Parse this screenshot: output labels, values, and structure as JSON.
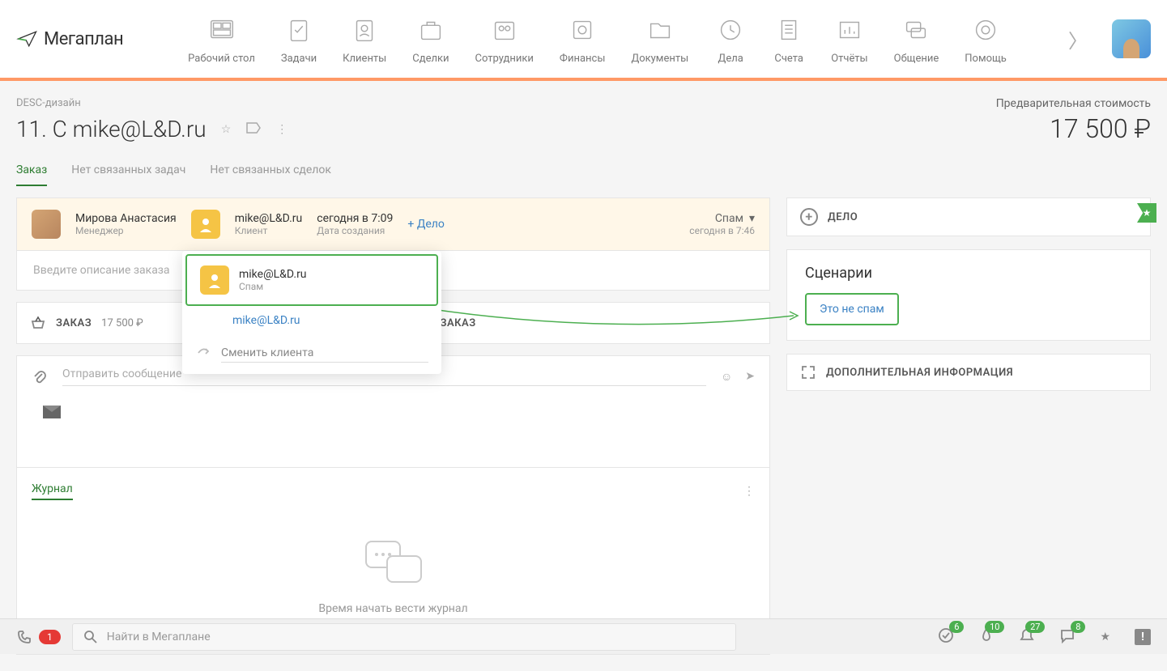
{
  "logo_text": "Мегаплан",
  "nav": [
    {
      "label": "Рабочий стол"
    },
    {
      "label": "Задачи"
    },
    {
      "label": "Клиенты"
    },
    {
      "label": "Сделки"
    },
    {
      "label": "Сотрудники"
    },
    {
      "label": "Финансы"
    },
    {
      "label": "Документы"
    },
    {
      "label": "Дела"
    },
    {
      "label": "Счета"
    },
    {
      "label": "Отчёты"
    },
    {
      "label": "Общение"
    },
    {
      "label": "Помощь"
    }
  ],
  "breadcrumb": "DESC-дизайн",
  "page_title": "11. С mike@L&D.ru",
  "price": {
    "label": "Предварительная стоимость",
    "value": "17 500 ₽"
  },
  "tabs": {
    "order": "Заказ",
    "no_tasks": "Нет связанных задач",
    "no_deals": "Нет связанных сделок"
  },
  "order_row": {
    "manager_name": "Мирова Анастасия",
    "manager_role": "Менеджер",
    "client_email": "mike@L&D.ru",
    "client_role": "Клиент",
    "created": "сегодня в 7:09",
    "created_label": "Дата создания",
    "add_deal": "+ Дело",
    "status": "Спам",
    "status_time": "сегодня в 7:46"
  },
  "desc_placeholder": "Введите описание заказа",
  "order_block": {
    "label": "ЗАКАЗ",
    "value": "17 500 ₽"
  },
  "order_block2": {
    "label": "ЗАКАЗ"
  },
  "msg_placeholder": "Отправить сообщение",
  "journal": {
    "tab": "Журнал",
    "empty": "Время начать вести журнал"
  },
  "side": {
    "deal": "ДЕЛО",
    "scenarios": "Сценарии",
    "not_spam": "Это не спам",
    "extra_info": "ДОПОЛНИТЕЛЬНАЯ ИНФОРМАЦИЯ"
  },
  "popup": {
    "selected_name": "mike@L&D.ru",
    "selected_status": "Спам",
    "link": "mike@L&D.ru",
    "change_client": "Сменить клиента"
  },
  "bottom": {
    "phone_badge": "1",
    "search_placeholder": "Найти в Мегаплане",
    "counts": {
      "check": "6",
      "fire": "10",
      "bell": "27",
      "chat": "8"
    }
  }
}
